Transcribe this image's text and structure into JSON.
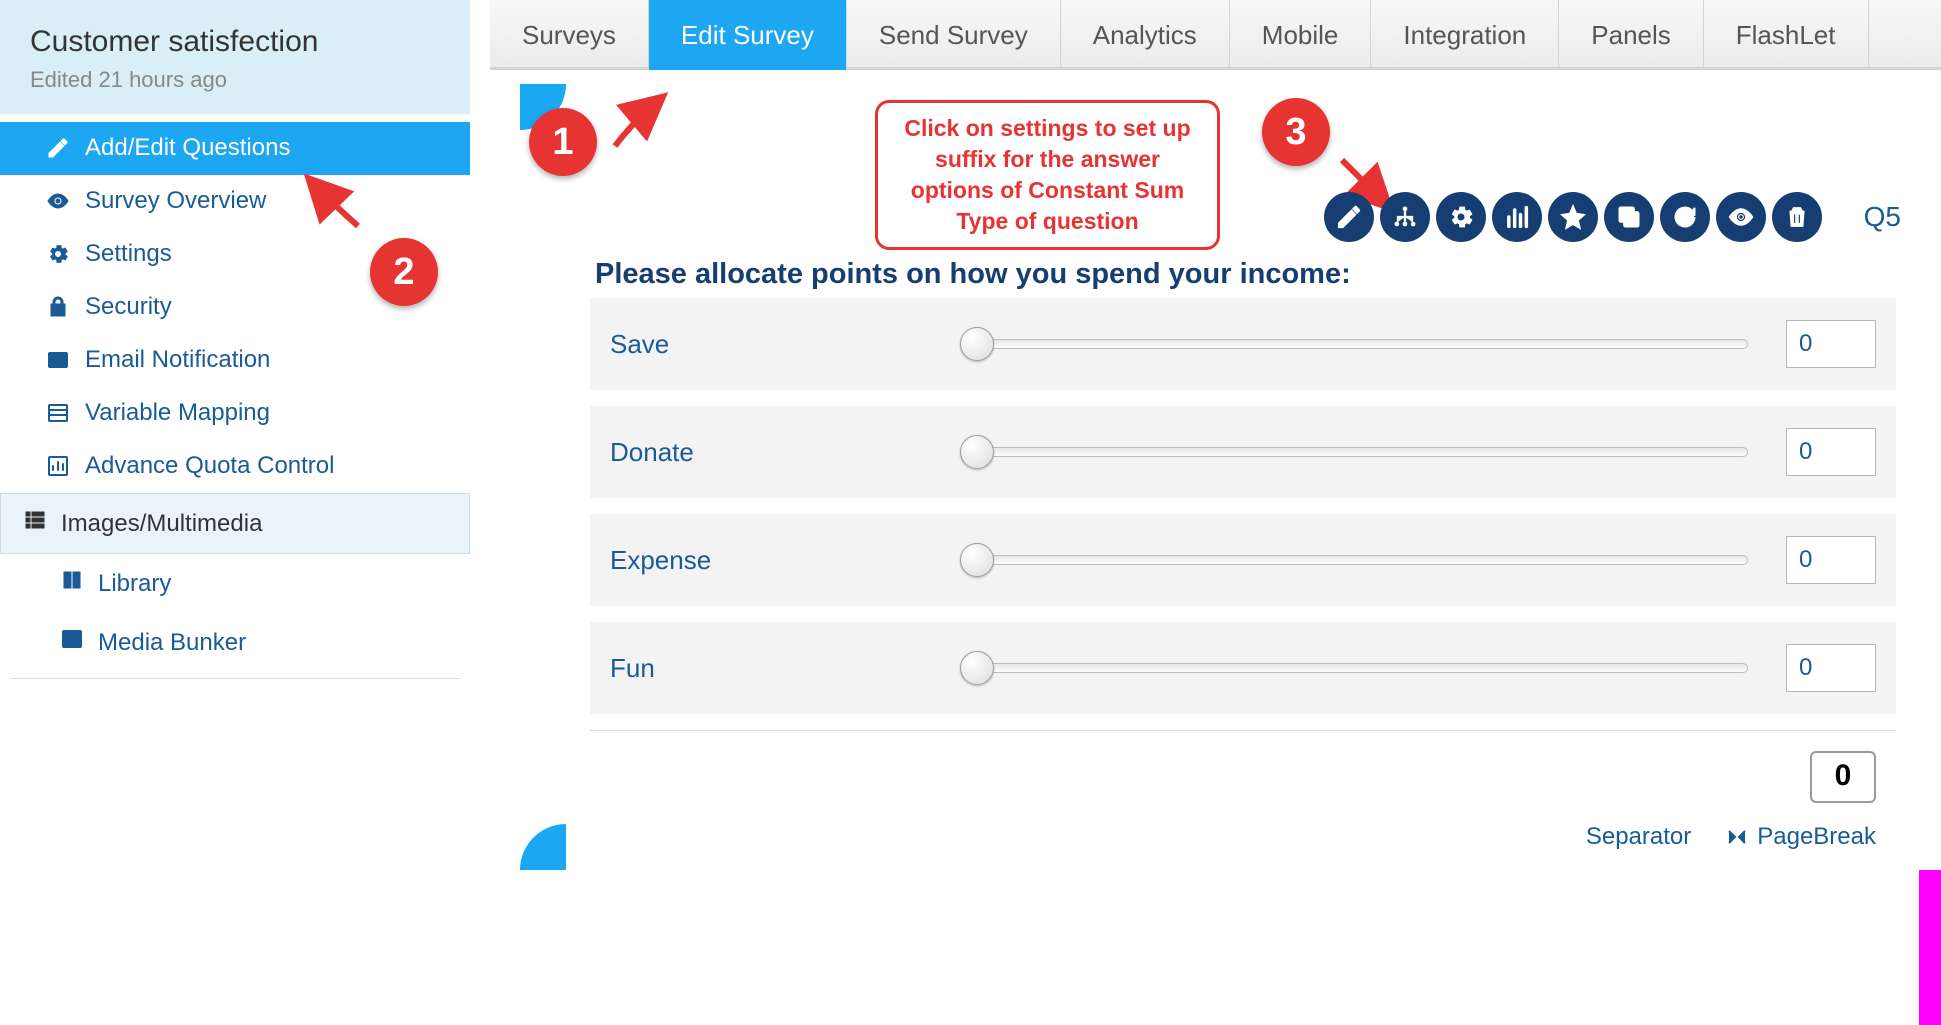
{
  "header": {
    "title": "Customer satisfection",
    "subtitle": "Edited 21 hours ago"
  },
  "sidebar": {
    "items": [
      {
        "label": "Add/Edit Questions",
        "active": true
      },
      {
        "label": "Survey Overview"
      },
      {
        "label": "Settings"
      },
      {
        "label": "Security"
      },
      {
        "label": "Email Notification"
      },
      {
        "label": "Variable Mapping"
      },
      {
        "label": "Advance Quota Control"
      }
    ],
    "section": {
      "label": "Images/Multimedia"
    },
    "subitems": [
      {
        "label": "Library"
      },
      {
        "label": "Media Bunker"
      }
    ]
  },
  "topnav": [
    {
      "label": "Surveys"
    },
    {
      "label": "Edit Survey",
      "active": true
    },
    {
      "label": "Send Survey"
    },
    {
      "label": "Analytics"
    },
    {
      "label": "Mobile"
    },
    {
      "label": "Integration"
    },
    {
      "label": "Panels"
    },
    {
      "label": "FlashLet"
    }
  ],
  "annotations": {
    "callout": "Click on settings to set up suffix for the answer options of Constant Sum Type of question",
    "badges": [
      "1",
      "2",
      "3"
    ]
  },
  "toolbar_icons": [
    "edit",
    "logic",
    "settings",
    "chart",
    "star",
    "copy",
    "refresh",
    "eye",
    "trash"
  ],
  "question": {
    "id": "Q5",
    "title": "Please allocate points on how you spend your income:",
    "rows": [
      {
        "label": "Save",
        "value": "0"
      },
      {
        "label": "Donate",
        "value": "0"
      },
      {
        "label": "Expense",
        "value": "0"
      },
      {
        "label": "Fun",
        "value": "0"
      }
    ],
    "total": "0",
    "footer": {
      "separator": "Separator",
      "pagebreak": "PageBreak"
    }
  },
  "colors": {
    "brand": "#1da6f2",
    "navy": "#173e72",
    "link": "#1a5a96",
    "danger": "#e63433"
  }
}
